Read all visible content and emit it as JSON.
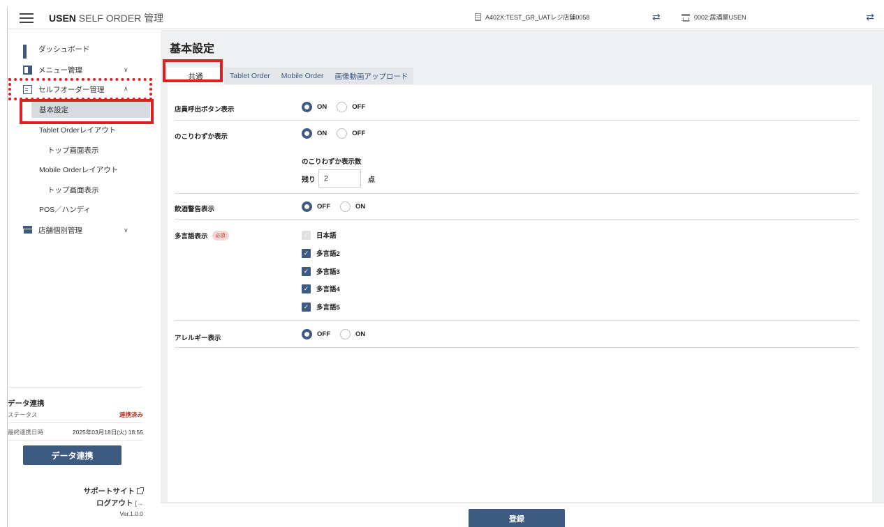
{
  "header": {
    "app_title_bold": "USEN",
    "app_title_rest": " SELF ORDER 管理",
    "store_code": "A402X:TEST_GR_UATレジ店舗0058",
    "shop_name": "0002:居酒屋USEN",
    "swap_icon": "⇄"
  },
  "sidebar": {
    "dashboard": "ダッシュボード",
    "menu_manage": "メニュー管理",
    "self_order_manage": "セルフオーダー管理",
    "sub_basic": "基本設定",
    "sub_tablet_layout": "Tablet Orderレイアウト",
    "sub_tablet_top": "トップ画面表示",
    "sub_mobile_layout": "Mobile Orderレイアウト",
    "sub_mobile_top": "トップ画面表示",
    "sub_pos": "POS／ハンディ",
    "store_manage": "店舗個別管理",
    "chevron_down": "∨",
    "chevron_up": "∧"
  },
  "sync": {
    "title": "データ連携",
    "status_label": "ステータス",
    "status_value": "連携済み",
    "last_label": "最終連携日時",
    "last_value": "2025年03月18日(火) 18:55",
    "button": "データ連携"
  },
  "footer_links": {
    "support": "サポートサイト",
    "logout": "ログアウト",
    "logout_icon": "[→",
    "version": "Ver.1.0.0"
  },
  "main": {
    "title": "基本設定",
    "tabs": [
      "共通",
      "Tablet Order",
      "Mobile Order",
      "画像動画アップロード"
    ],
    "rows": {
      "call_staff": {
        "label": "店員呼出ボタン表示",
        "opt1": "ON",
        "opt2": "OFF"
      },
      "few_left": {
        "label": "のこりわずか表示",
        "opt1": "ON",
        "opt2": "OFF",
        "count_label": "のこりわずか表示数",
        "prefix": "残り",
        "value": "2",
        "unit": "点"
      },
      "drink_warn": {
        "label": "飲酒警告表示",
        "opt1": "OFF",
        "opt2": "ON"
      },
      "multilang": {
        "label": "多言語表示",
        "badge": "必須",
        "langs": [
          "日本語",
          "多言語2",
          "多言語3",
          "多言語4",
          "多言語5"
        ]
      },
      "allergy": {
        "label": "アレルギー表示",
        "opt1": "OFF",
        "opt2": "ON"
      }
    },
    "submit": "登録",
    "check": "✓"
  },
  "colors": {
    "accent": "#3d5a80",
    "highlight": "#e02020",
    "background": "#eef0f2"
  }
}
